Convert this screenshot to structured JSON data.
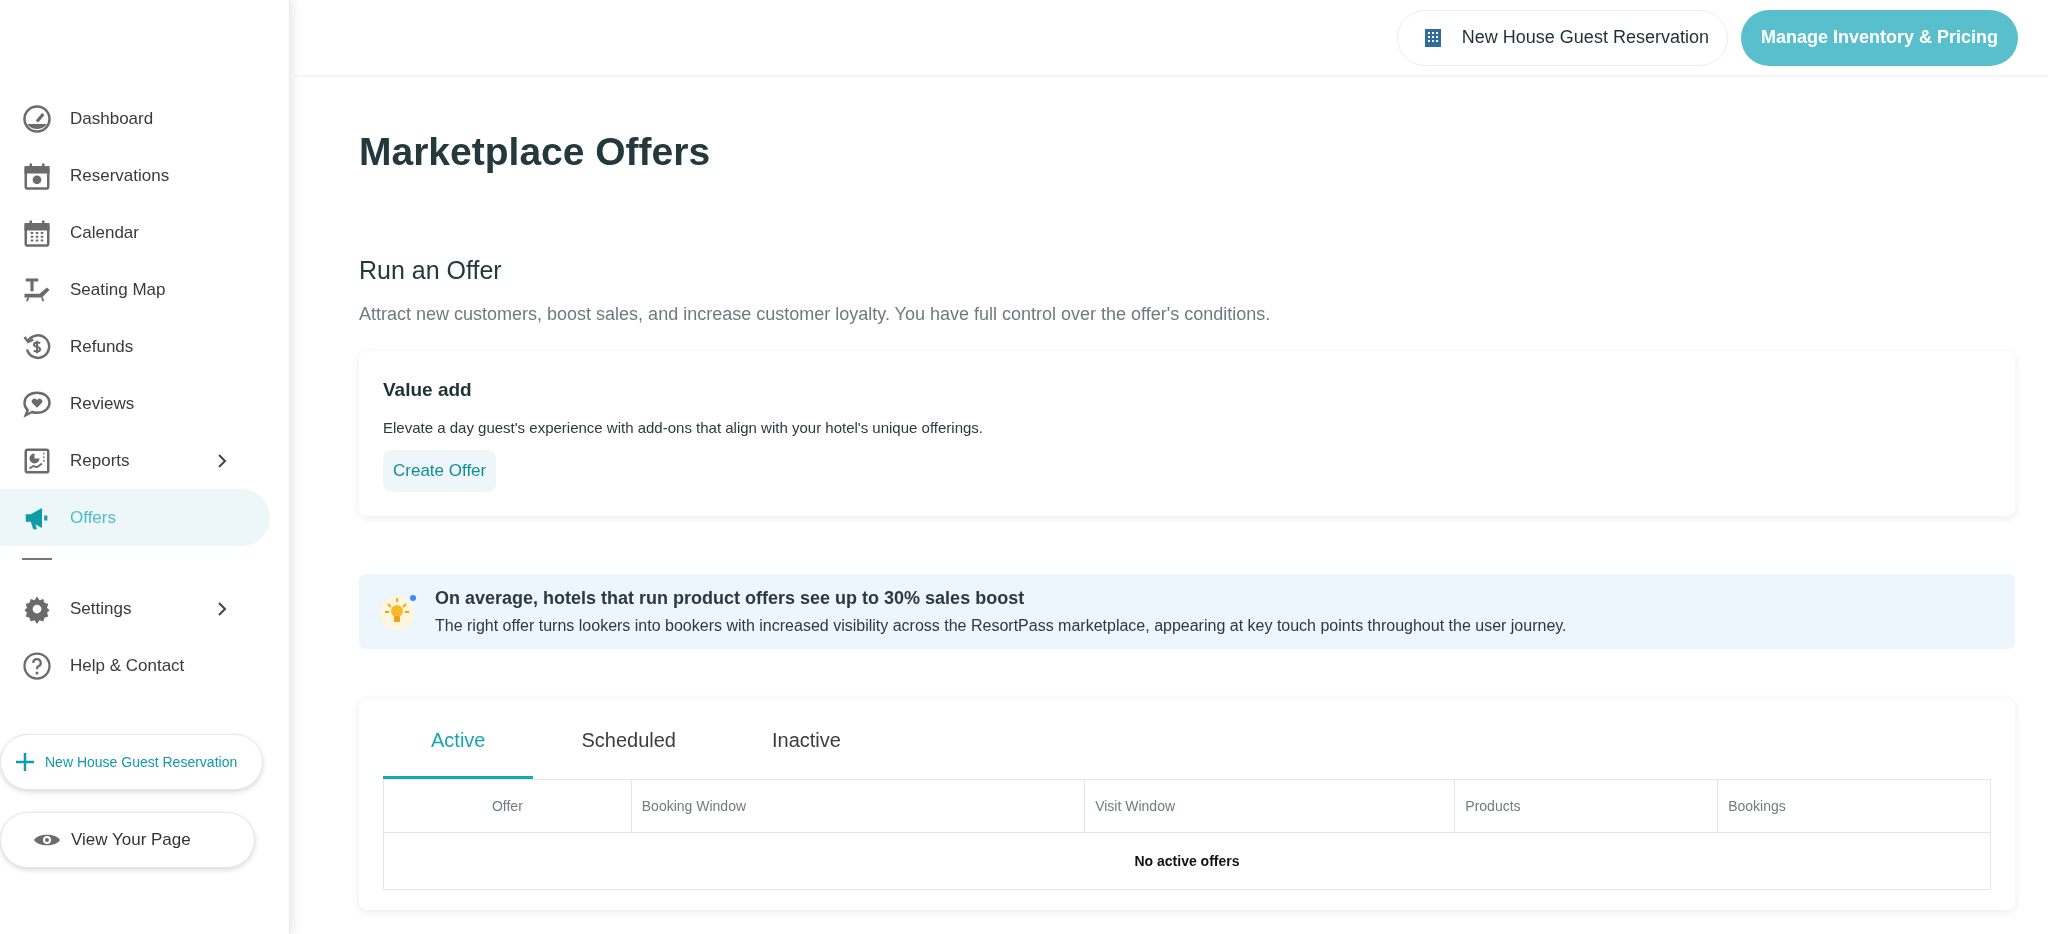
{
  "sidebar": {
    "items": [
      {
        "label": "Dashboard",
        "selected": false,
        "expandable": false
      },
      {
        "label": "Reservations",
        "selected": false,
        "expandable": false
      },
      {
        "label": "Calendar",
        "selected": false,
        "expandable": false
      },
      {
        "label": "Seating Map",
        "selected": false,
        "expandable": false
      },
      {
        "label": "Refunds",
        "selected": false,
        "expandable": false
      },
      {
        "label": "Reviews",
        "selected": false,
        "expandable": false
      },
      {
        "label": "Reports",
        "selected": false,
        "expandable": true
      },
      {
        "label": "Offers",
        "selected": true,
        "expandable": false
      }
    ],
    "lower_items": [
      {
        "label": "Settings",
        "selected": false,
        "expandable": true
      },
      {
        "label": "Help & Contact",
        "selected": false,
        "expandable": false
      }
    ],
    "buttons": [
      "New House Guest Reservation",
      "View Your Page"
    ]
  },
  "topbar": {
    "buttons": [
      "New House Guest Reservation",
      "Manage Inventory & Pricing"
    ]
  },
  "page": {
    "title": "Marketplace Offers",
    "section_title": "Run an Offer",
    "section_description": "Attract new customers, boost sales, and increase customer loyalty. You have full control over the offer's conditions.",
    "card": {
      "title": "Value add",
      "description": "Elevate a day guest's experience with add-ons that align with your hotel's unique offerings.",
      "button": "Create Offer"
    },
    "tip": {
      "title": "On average, hotels that run product offers see up to 30% sales boost",
      "text": "The right offer turns lookers into bookers with increased visibility across the ResortPass marketplace, appearing at key touch points throughout the user journey."
    },
    "tabs": [
      {
        "label": "Active",
        "selected": true
      },
      {
        "label": "Scheduled",
        "selected": false
      },
      {
        "label": "Inactive",
        "selected": false
      }
    ],
    "table": {
      "columns": [
        "Offer",
        "Booking Window",
        "Visit Window",
        "Products",
        "Bookings"
      ],
      "empty_message": "No active offers"
    }
  }
}
